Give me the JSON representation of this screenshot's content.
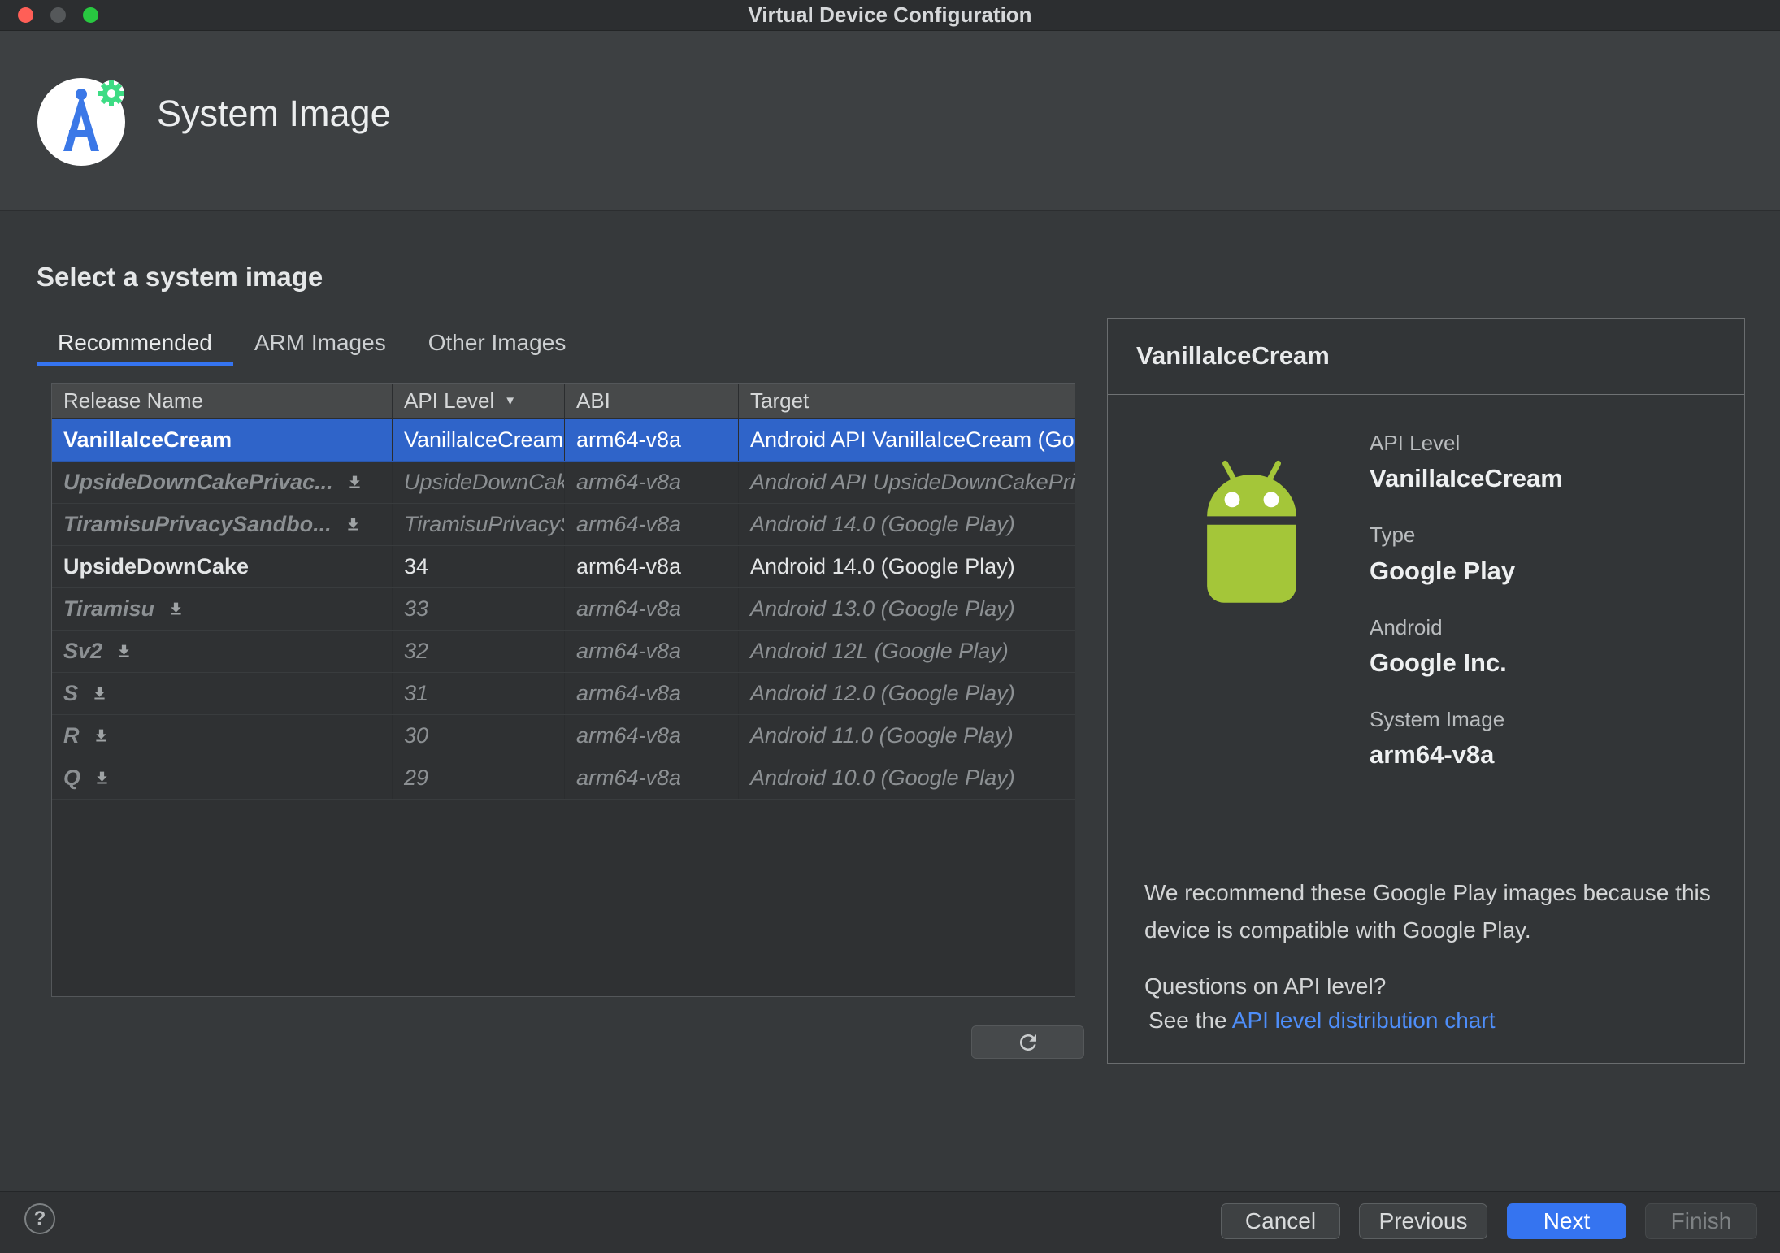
{
  "window": {
    "title": "Virtual Device Configuration"
  },
  "header": {
    "title": "System Image"
  },
  "main": {
    "heading": "Select a system image",
    "tabs": [
      {
        "label": "Recommended",
        "active": true
      },
      {
        "label": "ARM Images",
        "active": false
      },
      {
        "label": "Other Images",
        "active": false
      }
    ],
    "table": {
      "columns": [
        "Release Name",
        "API Level",
        "ABI",
        "Target"
      ],
      "sort_column": "API Level",
      "sort_direction": "desc",
      "rows": [
        {
          "release": "VanillaIceCream",
          "api": "VanillaIceCream",
          "abi": "arm64-v8a",
          "target": "Android API VanillaIceCream (Google Play)",
          "state": "selected",
          "download_icon": false
        },
        {
          "release": "UpsideDownCakePrivac...",
          "api": "UpsideDownCake",
          "abi": "arm64-v8a",
          "target": "Android API UpsideDownCakePrivacySandbox",
          "state": "download",
          "download_icon": true
        },
        {
          "release": "TiramisuPrivacySandbo...",
          "api": "TiramisuPrivacySandbox",
          "abi": "arm64-v8a",
          "target": "Android 14.0 (Google Play)",
          "state": "download",
          "download_icon": true
        },
        {
          "release": "UpsideDownCake",
          "api": "34",
          "abi": "arm64-v8a",
          "target": "Android 14.0 (Google Play)",
          "state": "installed",
          "download_icon": false
        },
        {
          "release": "Tiramisu",
          "api": "33",
          "abi": "arm64-v8a",
          "target": "Android 13.0 (Google Play)",
          "state": "download",
          "download_icon": true
        },
        {
          "release": "Sv2",
          "api": "32",
          "abi": "arm64-v8a",
          "target": "Android 12L (Google Play)",
          "state": "download",
          "download_icon": true
        },
        {
          "release": "S",
          "api": "31",
          "abi": "arm64-v8a",
          "target": "Android 12.0 (Google Play)",
          "state": "download",
          "download_icon": true
        },
        {
          "release": "R",
          "api": "30",
          "abi": "arm64-v8a",
          "target": "Android 11.0 (Google Play)",
          "state": "download",
          "download_icon": true
        },
        {
          "release": "Q",
          "api": "29",
          "abi": "arm64-v8a",
          "target": "Android 10.0 (Google Play)",
          "state": "download",
          "download_icon": true
        }
      ]
    }
  },
  "details": {
    "title": "VanillaIceCream",
    "fields": [
      {
        "label": "API Level",
        "value": "VanillaIceCream"
      },
      {
        "label": "Type",
        "value": "Google Play"
      },
      {
        "label": "Android",
        "value": "Google Inc."
      },
      {
        "label": "System Image",
        "value": "arm64-v8a"
      }
    ],
    "recommendation": "We recommend these Google Play images because this device is compatible with Google Play.",
    "question": "Questions on API level?",
    "see_the": "See the",
    "link_label": "API level distribution chart"
  },
  "footer": {
    "buttons": [
      {
        "label": "Cancel",
        "style": "default"
      },
      {
        "label": "Previous",
        "style": "default"
      },
      {
        "label": "Next",
        "style": "primary"
      },
      {
        "label": "Finish",
        "style": "disabled"
      }
    ]
  },
  "icons": {
    "sort_desc": "▼",
    "help": "?",
    "download": "download-arrow",
    "refresh": "circular-arrow"
  },
  "colors": {
    "accent": "#3574f0",
    "selection": "#2f64c9",
    "link": "#4e8ef9",
    "android_green": "#a4c639"
  }
}
